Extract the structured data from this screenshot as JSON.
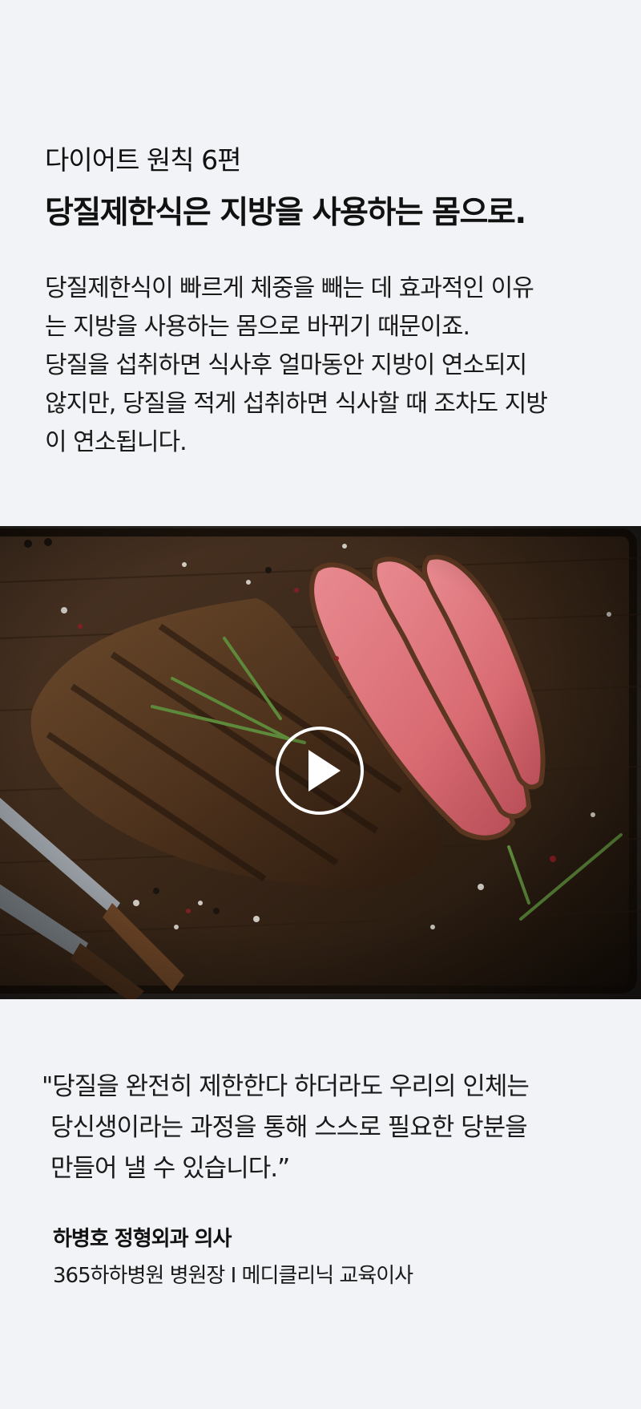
{
  "article": {
    "series": "다이어트 원칙 6편",
    "headline": "당질제한식은 지방을 사용하는 몸으로.",
    "body_lines": [
      "당질제한식이 빠르게 체중을 빼는 데 효과적인 이유",
      "는 지방을 사용하는 몸으로 바뀌기 때문이죠.",
      "당질을 섭취하면 식사후 얼마동안 지방이 연소되지",
      "않지만, 당질을 적게 섭취하면 식사할 때 조차도 지방",
      "이 연소됩니다."
    ]
  },
  "video": {
    "play_icon": "play-circle-icon",
    "scene": "sliced-steak-with-rosemary-on-board"
  },
  "quote": {
    "lines": [
      "\"당질을 완전히 제한한다 하더라도 우리의 인체는",
      "당신생이라는 과정을 통해 스스로 필요한 당분을",
      "만들어 낼 수 있습니다.”"
    ],
    "author_name": "하병호 정형외과 의사",
    "author_title": "365하하병원 병원장 I 메디클리닉 교육이사"
  },
  "colors": {
    "background": "#f2f3f6",
    "text": "#111111"
  }
}
